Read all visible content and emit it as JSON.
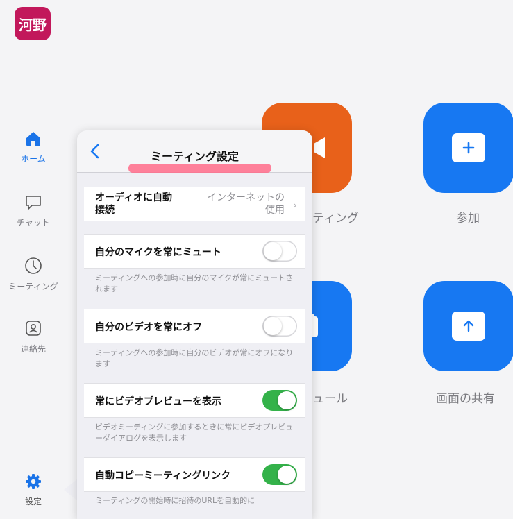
{
  "user": {
    "avatar_text": "河野",
    "avatar_color": "#c2185b"
  },
  "sidebar": {
    "items": [
      {
        "label": "ホーム",
        "icon": "home-icon",
        "active": true
      },
      {
        "label": "チャット",
        "icon": "chat-icon"
      },
      {
        "label": "ミーティング",
        "icon": "clock-icon"
      },
      {
        "label": "連絡先",
        "icon": "contacts-icon"
      },
      {
        "label": "設定",
        "icon": "gear-icon"
      }
    ]
  },
  "main": {
    "tiles": [
      {
        "label": "ティング",
        "icon": "video-camera-icon",
        "color": "#e8611a"
      },
      {
        "label": "参加",
        "icon": "plus-icon",
        "color": "#1778f2"
      },
      {
        "label": "ュール",
        "icon": "calendar-icon",
        "color": "#1778f2"
      },
      {
        "label": "画面の共有",
        "icon": "upload-arrow-icon",
        "color": "#1778f2"
      }
    ]
  },
  "settings": {
    "title": "ミーティング設定",
    "audio": {
      "label": "オーディオに自動\n接続",
      "value": "インターネットの\n使用"
    },
    "mute_mic": {
      "label": "自分のマイクを常にミュート",
      "on": false,
      "desc": "ミーティングへの参加時に自分のマイクが常にミュートされます"
    },
    "video_off": {
      "label": "自分のビデオを常にオフ",
      "on": false,
      "desc": "ミーティングへの参加時に自分のビデオが常にオフになります"
    },
    "video_preview": {
      "label": "常にビデオプレビューを表示",
      "on": true,
      "desc": "ビデオミーティングに参加するときに常にビデオプレビューダイアログを表示します"
    },
    "copy_link": {
      "label": "自動コピーミーティングリンク",
      "on": true,
      "desc": "ミーティングの開始時に招待のURLを自動的に"
    }
  },
  "colors": {
    "accent": "#1778f2",
    "toggle_on": "#34b24a",
    "highlight": "#ff6b8a"
  }
}
